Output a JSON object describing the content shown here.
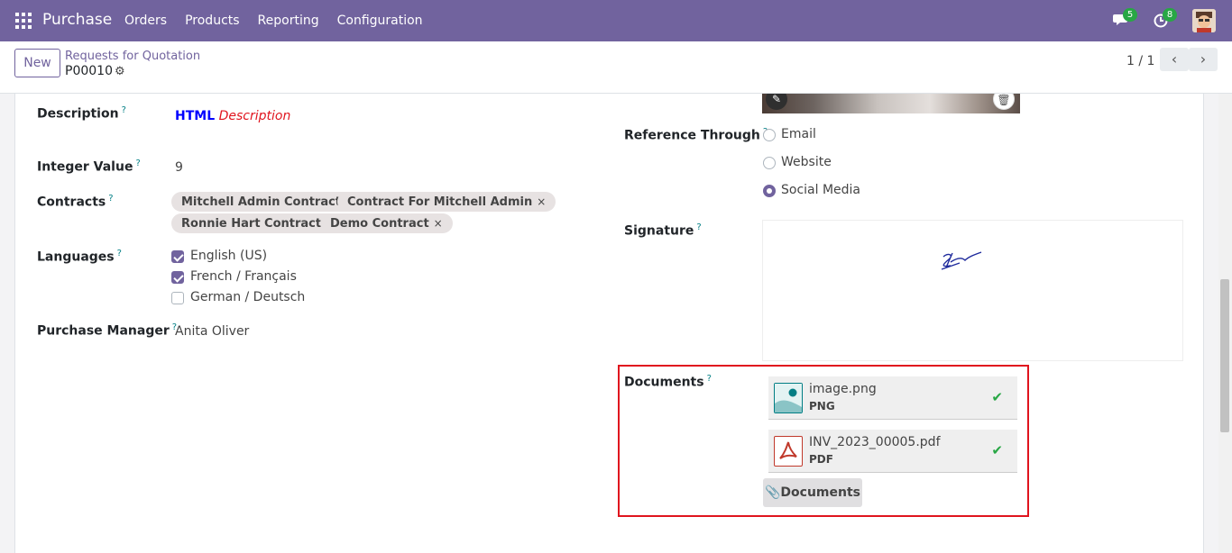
{
  "navbar": {
    "brand": "Purchase",
    "menu": [
      "Orders",
      "Products",
      "Reporting",
      "Configuration"
    ],
    "messages_count": "5",
    "activities_count": "8",
    "accent": "#71639e"
  },
  "control_panel": {
    "new_label": "New",
    "breadcrumb": "Requests for Quotation",
    "record_name": "P00010",
    "pager": "1 / 1"
  },
  "form": {
    "description": {
      "label": "Description",
      "help": "?",
      "html_part": "HTML",
      "desc_part": "Description"
    },
    "integer_value": {
      "label": "Integer Value",
      "help": "?",
      "value": "9"
    },
    "contracts": {
      "label": "Contracts",
      "help": "?",
      "tags": [
        "Mitchell Admin Contract",
        "Contract For Mitchell Admin",
        "Ronnie Hart Contract",
        "Demo Contract"
      ],
      "remove_glyph": "×"
    },
    "languages": {
      "label": "Languages",
      "help": "?",
      "options": [
        {
          "label": "English (US)",
          "checked": true
        },
        {
          "label": "French / Français",
          "checked": true
        },
        {
          "label": "German / Deutsch",
          "checked": false
        }
      ]
    },
    "purchase_manager": {
      "label": "Purchase Manager",
      "help": "?",
      "value": "Anita Oliver"
    },
    "reference_through": {
      "label": "Reference Through",
      "help": "?",
      "options": [
        {
          "label": "Email",
          "selected": false
        },
        {
          "label": "Website",
          "selected": false
        },
        {
          "label": "Social Media",
          "selected": true
        }
      ]
    },
    "signature": {
      "label": "Signature",
      "help": "?"
    },
    "documents": {
      "label": "Documents",
      "help": "?",
      "files": [
        {
          "name": "image.png",
          "type": "PNG",
          "icon": "image-file-icon"
        },
        {
          "name": "INV_2023_00005.pdf",
          "type": "PDF",
          "icon": "pdf-file-icon"
        }
      ],
      "button_label": "Documents"
    }
  }
}
